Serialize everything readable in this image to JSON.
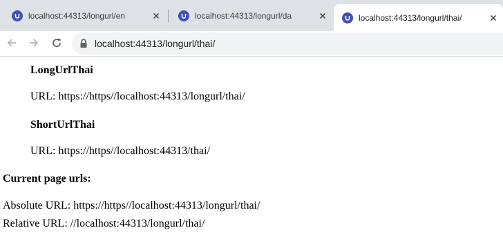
{
  "browser": {
    "tabs": [
      {
        "title": "localhost:44313/longurl/en",
        "active": false
      },
      {
        "title": "localhost:44313/longurl/da",
        "active": false
      },
      {
        "title": "localhost:44313/longurl/thai/",
        "active": true
      }
    ],
    "address": "localhost:44313/longurl/thai/",
    "favicon_color": "#3f51b5"
  },
  "page": {
    "long_heading": "LongUrlThai",
    "long_url": "URL: https://https//localhost:44313/longurl/thai/",
    "short_heading": "ShortUrlThai",
    "short_url": "URL: https://https//localhost:44313/thai/",
    "current_heading": "Current page urls:",
    "absolute_url": "Absolute URL: https://https//localhost:44313/longurl/thai/",
    "relative_url": "Relative URL: //localhost:44313/longurl/thai/"
  }
}
